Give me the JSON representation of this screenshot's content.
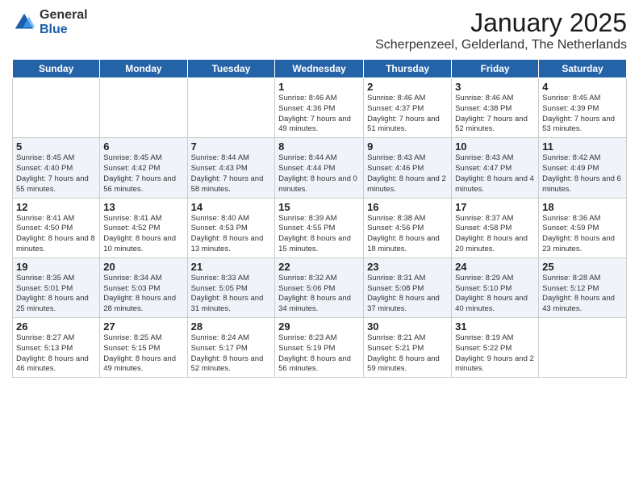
{
  "logo": {
    "general": "General",
    "blue": "Blue"
  },
  "title": "January 2025",
  "location": "Scherpenzeel, Gelderland, The Netherlands",
  "weekdays": [
    "Sunday",
    "Monday",
    "Tuesday",
    "Wednesday",
    "Thursday",
    "Friday",
    "Saturday"
  ],
  "weeks": [
    [
      {
        "day": "",
        "info": ""
      },
      {
        "day": "",
        "info": ""
      },
      {
        "day": "",
        "info": ""
      },
      {
        "day": "1",
        "info": "Sunrise: 8:46 AM\nSunset: 4:36 PM\nDaylight: 7 hours\nand 49 minutes."
      },
      {
        "day": "2",
        "info": "Sunrise: 8:46 AM\nSunset: 4:37 PM\nDaylight: 7 hours\nand 51 minutes."
      },
      {
        "day": "3",
        "info": "Sunrise: 8:46 AM\nSunset: 4:38 PM\nDaylight: 7 hours\nand 52 minutes."
      },
      {
        "day": "4",
        "info": "Sunrise: 8:45 AM\nSunset: 4:39 PM\nDaylight: 7 hours\nand 53 minutes."
      }
    ],
    [
      {
        "day": "5",
        "info": "Sunrise: 8:45 AM\nSunset: 4:40 PM\nDaylight: 7 hours\nand 55 minutes."
      },
      {
        "day": "6",
        "info": "Sunrise: 8:45 AM\nSunset: 4:42 PM\nDaylight: 7 hours\nand 56 minutes."
      },
      {
        "day": "7",
        "info": "Sunrise: 8:44 AM\nSunset: 4:43 PM\nDaylight: 7 hours\nand 58 minutes."
      },
      {
        "day": "8",
        "info": "Sunrise: 8:44 AM\nSunset: 4:44 PM\nDaylight: 8 hours\nand 0 minutes."
      },
      {
        "day": "9",
        "info": "Sunrise: 8:43 AM\nSunset: 4:46 PM\nDaylight: 8 hours\nand 2 minutes."
      },
      {
        "day": "10",
        "info": "Sunrise: 8:43 AM\nSunset: 4:47 PM\nDaylight: 8 hours\nand 4 minutes."
      },
      {
        "day": "11",
        "info": "Sunrise: 8:42 AM\nSunset: 4:49 PM\nDaylight: 8 hours\nand 6 minutes."
      }
    ],
    [
      {
        "day": "12",
        "info": "Sunrise: 8:41 AM\nSunset: 4:50 PM\nDaylight: 8 hours\nand 8 minutes."
      },
      {
        "day": "13",
        "info": "Sunrise: 8:41 AM\nSunset: 4:52 PM\nDaylight: 8 hours\nand 10 minutes."
      },
      {
        "day": "14",
        "info": "Sunrise: 8:40 AM\nSunset: 4:53 PM\nDaylight: 8 hours\nand 13 minutes."
      },
      {
        "day": "15",
        "info": "Sunrise: 8:39 AM\nSunset: 4:55 PM\nDaylight: 8 hours\nand 15 minutes."
      },
      {
        "day": "16",
        "info": "Sunrise: 8:38 AM\nSunset: 4:56 PM\nDaylight: 8 hours\nand 18 minutes."
      },
      {
        "day": "17",
        "info": "Sunrise: 8:37 AM\nSunset: 4:58 PM\nDaylight: 8 hours\nand 20 minutes."
      },
      {
        "day": "18",
        "info": "Sunrise: 8:36 AM\nSunset: 4:59 PM\nDaylight: 8 hours\nand 23 minutes."
      }
    ],
    [
      {
        "day": "19",
        "info": "Sunrise: 8:35 AM\nSunset: 5:01 PM\nDaylight: 8 hours\nand 25 minutes."
      },
      {
        "day": "20",
        "info": "Sunrise: 8:34 AM\nSunset: 5:03 PM\nDaylight: 8 hours\nand 28 minutes."
      },
      {
        "day": "21",
        "info": "Sunrise: 8:33 AM\nSunset: 5:05 PM\nDaylight: 8 hours\nand 31 minutes."
      },
      {
        "day": "22",
        "info": "Sunrise: 8:32 AM\nSunset: 5:06 PM\nDaylight: 8 hours\nand 34 minutes."
      },
      {
        "day": "23",
        "info": "Sunrise: 8:31 AM\nSunset: 5:08 PM\nDaylight: 8 hours\nand 37 minutes."
      },
      {
        "day": "24",
        "info": "Sunrise: 8:29 AM\nSunset: 5:10 PM\nDaylight: 8 hours\nand 40 minutes."
      },
      {
        "day": "25",
        "info": "Sunrise: 8:28 AM\nSunset: 5:12 PM\nDaylight: 8 hours\nand 43 minutes."
      }
    ],
    [
      {
        "day": "26",
        "info": "Sunrise: 8:27 AM\nSunset: 5:13 PM\nDaylight: 8 hours\nand 46 minutes."
      },
      {
        "day": "27",
        "info": "Sunrise: 8:25 AM\nSunset: 5:15 PM\nDaylight: 8 hours\nand 49 minutes."
      },
      {
        "day": "28",
        "info": "Sunrise: 8:24 AM\nSunset: 5:17 PM\nDaylight: 8 hours\nand 52 minutes."
      },
      {
        "day": "29",
        "info": "Sunrise: 8:23 AM\nSunset: 5:19 PM\nDaylight: 8 hours\nand 56 minutes."
      },
      {
        "day": "30",
        "info": "Sunrise: 8:21 AM\nSunset: 5:21 PM\nDaylight: 8 hours\nand 59 minutes."
      },
      {
        "day": "31",
        "info": "Sunrise: 8:19 AM\nSunset: 5:22 PM\nDaylight: 9 hours\nand 2 minutes."
      },
      {
        "day": "",
        "info": ""
      }
    ]
  ]
}
